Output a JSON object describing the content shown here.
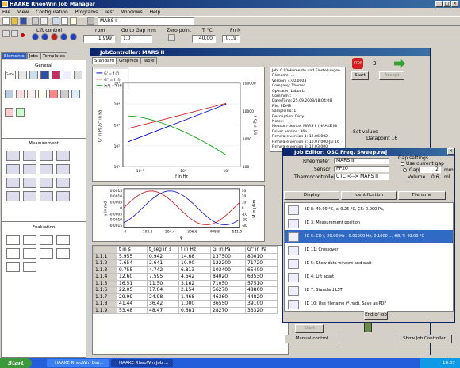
{
  "main_window": {
    "title": "HAAKE RheoWin Job Manager"
  },
  "menu": [
    "File",
    "View",
    "Configuration",
    "Programs",
    "Test",
    "Windows",
    "Help"
  ],
  "device": {
    "value": "MARS II"
  },
  "controls": {
    "lift_control": {
      "label": "Lift control"
    },
    "rpm": {
      "label": "rpm",
      "value": "1.999"
    },
    "gap": {
      "label": "Go to Gap mm",
      "value": "1.0"
    },
    "zero": {
      "label": "Zero point"
    },
    "temp": {
      "label": "T °C",
      "value": "40.00"
    },
    "force": {
      "label": "Fn N",
      "value": "0.19"
    }
  },
  "sidebar": {
    "tabs": [
      "Elements",
      "Jobs",
      "Templates"
    ],
    "groups": [
      "General",
      "Measurement",
      "Evaluation"
    ]
  },
  "job_controller": {
    "title": "JobController: MARS II",
    "tabs": [
      "Standard",
      "Graphics",
      "Table"
    ],
    "legend": [
      "G' = f (f)",
      "G'' = f (f)",
      "|η*| = f (f)"
    ],
    "chart1": {
      "ylabel": "G' in Pa,G'' in Pa",
      "ylabel_right": "|η*| in Pa s",
      "xlabel": "f in Hz",
      "yticks": [
        "10⁵",
        "10⁴",
        "10³",
        "10²",
        "10¹"
      ],
      "yticks_right": [
        "100000",
        "10000",
        "1000",
        "100"
      ],
      "xticks": [
        "10⁻¹",
        "10⁰",
        "10¹"
      ]
    },
    "chart2": {
      "ylabel": "γ in rad",
      "ylabel_right": "M in μNm",
      "xlabel": "φ",
      "yticks": [
        "0.0015",
        "0.0010",
        "0.0005",
        "0",
        "-0.0005",
        "-0.0010",
        "-0.0015"
      ],
      "yticks_right": [
        "30",
        "20",
        "10",
        "0",
        "-10",
        "-20",
        "-30"
      ],
      "xticks": [
        "0",
        "102.2",
        "204.4",
        "306.6",
        "408.8",
        "511.0"
      ]
    },
    "table": {
      "headers": [
        "t in s",
        "t_seg in s",
        "f in Hz",
        "G' in Pa",
        "G'' in Pa"
      ],
      "rows": [
        [
          "1.1.1",
          "5.955",
          "0.942",
          "14.68",
          "137500",
          "80010"
        ],
        [
          "1.1.2",
          "7.654",
          "2.641",
          "10.00",
          "122200",
          "71720"
        ],
        [
          "1.1.3",
          "9.755",
          "4.742",
          "6.813",
          "103400",
          "65400"
        ],
        [
          "1.1.4",
          "12.60",
          "7.595",
          "4.642",
          "84020",
          "63530"
        ],
        [
          "1.1.5",
          "16.51",
          "11.50",
          "3.162",
          "71050",
          "57510"
        ],
        [
          "1.1.6",
          "22.05",
          "17.04",
          "2.154",
          "56270",
          "48800"
        ],
        [
          "1.1.7",
          "29.99",
          "24.98",
          "1.468",
          "46360",
          "44820"
        ],
        [
          "1.1.8",
          "41.44",
          "36.42",
          "1.000",
          "36550",
          "39100"
        ],
        [
          "1.1.9",
          "53.48",
          "48.47",
          "0.681",
          "28270",
          "33320"
        ]
      ]
    },
    "info": [
      "Job: C:\\Dokumente und Einstellungen",
      "Filename: ...",
      "Version: 4.00.0003",
      "Company: Thermo",
      "Operator: Labor LI",
      "Comment:",
      "Date/Time: 25.09.2008/18:04:08",
      "File: PDMS",
      "Sample no: 1",
      "Description: Dirty",
      "Notes:",
      "Measure device: MARS II (HAAKE Mi",
      "Driver version: 36a",
      "Firmware version 1: 12.06.002",
      "Firmware version 2: 10.07.000-Jul 16",
      "Firmware version 3: 12.03.000"
    ],
    "start_label": "Start",
    "accept_label": "Accept",
    "number": "3",
    "set_values_label": "Set values",
    "datapoint_label": "Datapoint 16"
  },
  "job_editor": {
    "title": "Job Editor: OSC Freq. Sweep.rwj",
    "rheometer_label": "Rheometer",
    "rheometer_value": "MARS II",
    "sensor_label": "Sensor",
    "sensor_value": "PP20",
    "thermo_label": "Thermocontroller",
    "thermo_value": "UTC <--> MARS II",
    "gap_settings_label": "Gap settings",
    "use_current_gap": "Use current gap",
    "gap_label": "Gap",
    "gap_value": "2",
    "gap_unit": "mm",
    "volume_label": "Volume",
    "volume_value": "0.6",
    "volume_unit": "ml",
    "display_btn": "Display",
    "ident_btn": "Identification",
    "filename_btn": "Filename",
    "steps": [
      "ID 8: 40.00 °C, ≥ 0.25 °C, CS: 0.000 Pa,",
      "ID 3: Measurement position",
      "ID 6: CD f, 20.00 Hz - 0.01000 Hz, 0.1000 ... #8, T: 40.00 °C",
      "ID 11: Crossover",
      "ID 5: Show data window and wait",
      "ID 4: Lift apart",
      "ID 7: Standard LST",
      "ID 10: Use filename (*.rwd), Save as PDF"
    ],
    "end_label": "End of job",
    "start_btn": "Start",
    "manual_btn": "Manual control",
    "show_jc_btn": "Show Job Controller"
  },
  "taskbar": {
    "start": "Start",
    "tasks": [
      "HAAKE RheoWin Dat...",
      "HAAKE RheoWin Job ..."
    ],
    "clock": "18:07"
  },
  "colors": {
    "title": "#0a246a",
    "taskbar": "#245edb",
    "start": "#3c9a3c",
    "series_blue": "#0000c8",
    "series_red": "#d02020",
    "series_green": "#10a010"
  }
}
